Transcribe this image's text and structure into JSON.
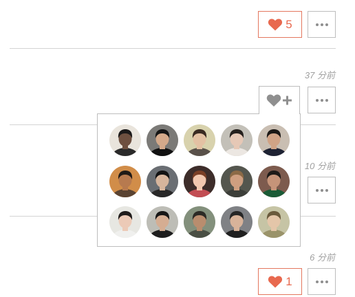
{
  "top_like": {
    "count": "5"
  },
  "timestamps": [
    "37 分前",
    "10 分前",
    "6 分前"
  ],
  "bottom_like": {
    "count": "1"
  },
  "avatars": [
    {
      "bg": "#e9e4dc",
      "skin": "#6e5040",
      "hair": "#1c1a1a",
      "shirt": "#2a2a2a"
    },
    {
      "bg": "#7b7a77",
      "skin": "#d4a98a",
      "hair": "#151515",
      "shirt": "#111111"
    },
    {
      "bg": "#d8d2ad",
      "skin": "#e3c1a3",
      "hair": "#3a2b22",
      "shirt": "#59514a"
    },
    {
      "bg": "#c3c0b8",
      "skin": "#e6c8b6",
      "hair": "#25201d",
      "shirt": "#ece7e2"
    },
    {
      "bg": "#c9beb2",
      "skin": "#d0a386",
      "hair": "#1b1816",
      "shirt": "#1e2233"
    },
    {
      "bg": "#d18d49",
      "skin": "#b77a4f",
      "hair": "#201a16",
      "shirt": "#5a4332"
    },
    {
      "bg": "#6a6e73",
      "skin": "#d7b59c",
      "hair": "#121212",
      "shirt": "#282828"
    },
    {
      "bg": "#3d2d2a",
      "skin": "#f1c7af",
      "hair": "#7a3f26",
      "shirt": "#c24d53"
    },
    {
      "bg": "#54564e",
      "skin": "#cf9f80",
      "hair": "#8c6a46",
      "shirt": "#3c3e39"
    },
    {
      "bg": "#7d5b4e",
      "skin": "#c59479",
      "hair": "#1d1a18",
      "shirt": "#1a5b36"
    },
    {
      "bg": "#e7e7e2",
      "skin": "#eccab7",
      "hair": "#201c1b",
      "shirt": "#f0f0ee"
    },
    {
      "bg": "#bdbdb6",
      "skin": "#d5ad92",
      "hair": "#161616",
      "shirt": "#1e1e1e"
    },
    {
      "bg": "#83907c",
      "skin": "#b98d6e",
      "hair": "#2b2a25",
      "shirt": "#4a4f44"
    },
    {
      "bg": "#7f8185",
      "skin": "#d8b39a",
      "hair": "#262626",
      "shirt": "#202020"
    },
    {
      "bg": "#c6c4a5",
      "skin": "#e4c6a9",
      "hair": "#6a5a3c",
      "shirt": "#9a936a"
    }
  ],
  "colors": {
    "accent": "#e8694f",
    "border": "#bdbdbd",
    "divider": "#d3d3d3",
    "muted_text": "#a0a0a0",
    "icon_gray": "#8f8f8f"
  },
  "icons": {
    "like": "heart-icon",
    "add_like": "heart-plus-icon",
    "more": "more-dots-icon"
  }
}
